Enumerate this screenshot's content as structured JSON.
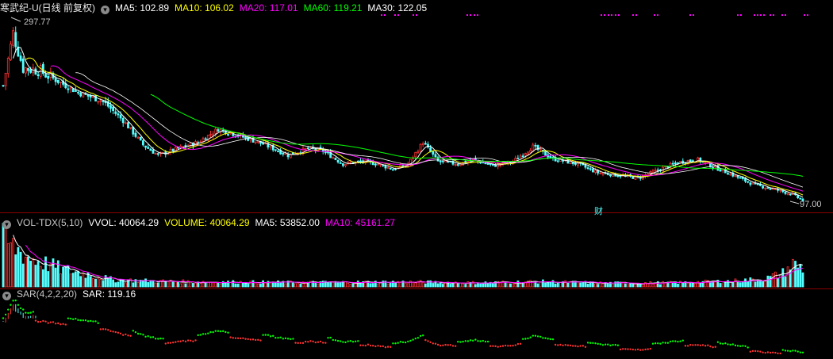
{
  "colors": {
    "up": "#ff3232",
    "down": "#54ffff",
    "ma5": "#ffffff",
    "ma10": "#ffff00",
    "ma20": "#ff00ff",
    "ma60": "#00ff00",
    "ma30": "#ffffff",
    "vma5": "#ffffff",
    "vma10": "#ff00ff",
    "sar_up": "#ff3232",
    "sar_down": "#00ff00",
    "divider": "#8b0000",
    "text": "#c8c8c8"
  },
  "price_panel": {
    "title": "寒武纪-U(日线 前复权)",
    "circle_icon": "chevron-down-icon",
    "ma5": "MA5: 102.89",
    "ma10": "MA10: 106.02",
    "ma20": "MA20: 117.01",
    "ma60": "MA60: 119.21",
    "ma30": "MA30: 122.05",
    "high_label": "297.77",
    "low_label": "97.00",
    "fin_marker": "财"
  },
  "volume_panel": {
    "title": "VOL-TDX(5,10)",
    "vvol": "VVOL: 40064.29",
    "volume": "VOLUME: 40064.29",
    "ma5": "MA5: 53852.00",
    "ma10": "MA10: 45161.27"
  },
  "sar_panel": {
    "title": "SAR(4,2,2,20)",
    "sar": "SAR: 119.16"
  },
  "chart_data": {
    "type": "candlestick",
    "y_range": [
      90,
      310
    ],
    "volume_range": [
      0,
      100000
    ],
    "high": 297.77,
    "low": 97.0,
    "anchors": [
      [
        0,
        230
      ],
      [
        4,
        290
      ],
      [
        8,
        250
      ],
      [
        14,
        248
      ],
      [
        22,
        235
      ],
      [
        30,
        222
      ],
      [
        40,
        212
      ],
      [
        48,
        190
      ],
      [
        56,
        162
      ],
      [
        62,
        150
      ],
      [
        70,
        158
      ],
      [
        78,
        165
      ],
      [
        86,
        180
      ],
      [
        95,
        172
      ],
      [
        104,
        163
      ],
      [
        114,
        150
      ],
      [
        122,
        158
      ],
      [
        128,
        155
      ],
      [
        136,
        140
      ],
      [
        144,
        143
      ],
      [
        150,
        140
      ],
      [
        156,
        134
      ],
      [
        162,
        140
      ],
      [
        168,
        165
      ],
      [
        174,
        143
      ],
      [
        182,
        140
      ],
      [
        188,
        145
      ],
      [
        196,
        138
      ],
      [
        204,
        143
      ],
      [
        212,
        160
      ],
      [
        220,
        146
      ],
      [
        230,
        140
      ],
      [
        238,
        130
      ],
      [
        244,
        128
      ],
      [
        254,
        124
      ],
      [
        262,
        133
      ],
      [
        270,
        142
      ],
      [
        278,
        145
      ],
      [
        284,
        137
      ],
      [
        290,
        130
      ],
      [
        296,
        122
      ],
      [
        300,
        117
      ],
      [
        304,
        114
      ],
      [
        310,
        110
      ],
      [
        316,
        105
      ],
      [
        320,
        98
      ]
    ],
    "volume_anchors": [
      [
        0,
        80000
      ],
      [
        4,
        70000
      ],
      [
        10,
        52000
      ],
      [
        16,
        42000
      ],
      [
        24,
        30000
      ],
      [
        34,
        22000
      ],
      [
        44,
        12000
      ],
      [
        70,
        9000
      ],
      [
        120,
        7500
      ],
      [
        160,
        8500
      ],
      [
        190,
        7000
      ],
      [
        215,
        9000
      ],
      [
        240,
        6500
      ],
      [
        268,
        7000
      ],
      [
        292,
        10000
      ],
      [
        305,
        14000
      ],
      [
        312,
        24000
      ],
      [
        316,
        40000
      ],
      [
        320,
        33000
      ]
    ],
    "sar_marker_positions_x": [
      480,
      497,
      520,
      588,
      597,
      757,
      766,
      775,
      797,
      824,
      869,
      929,
      950,
      958,
      970,
      985,
      1013
    ]
  }
}
